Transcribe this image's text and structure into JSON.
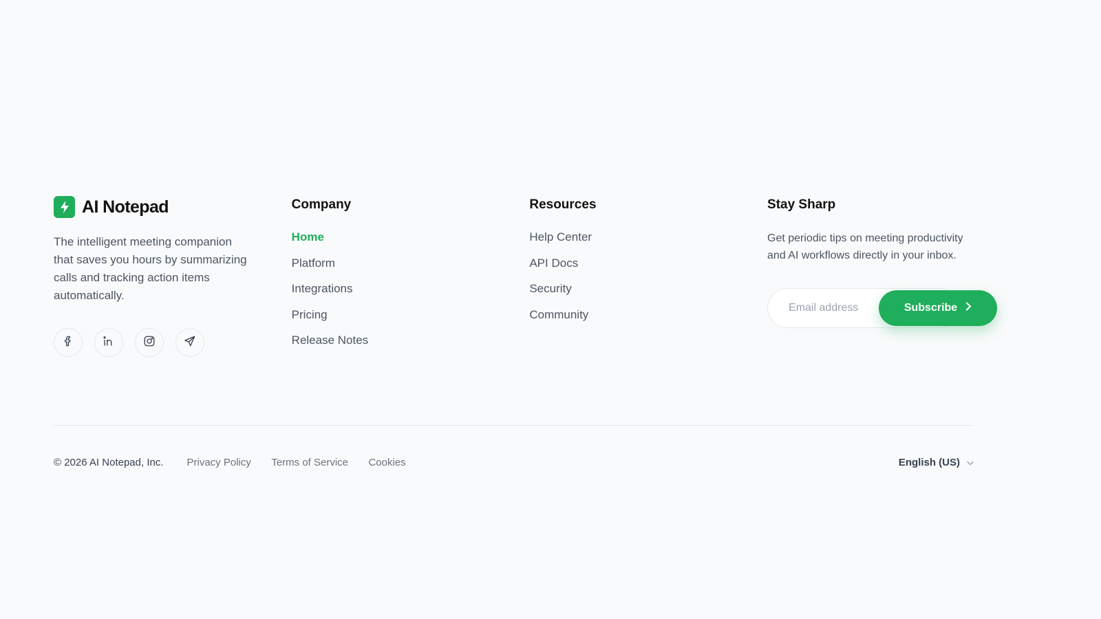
{
  "brand": {
    "name": "AI Notepad",
    "icon": "lightning-bolt-icon",
    "accent": "#1fae5b",
    "description": "The intelligent meeting companion that saves you hours by summarizing calls and tracking action items automatically."
  },
  "socials": [
    {
      "icon": "facebook-icon"
    },
    {
      "icon": "linkedin-icon"
    },
    {
      "icon": "instagram-icon"
    },
    {
      "icon": "telegram-icon"
    }
  ],
  "company": {
    "title": "Company",
    "links": [
      "Home",
      "Platform",
      "Integrations",
      "Pricing",
      "Release Notes"
    ],
    "active": "Home"
  },
  "resources": {
    "title": "Resources",
    "links": [
      "Help Center",
      "API Docs",
      "Security",
      "Community"
    ]
  },
  "newsletter": {
    "title": "Stay Sharp",
    "description": "Get periodic tips on meeting productivity and AI workflows directly in your inbox.",
    "email_placeholder": "Email address",
    "email_value": "",
    "button_label": "Subscribe",
    "button_icon": "chevron-right-icon"
  },
  "bottom": {
    "copyright": "© 2026 AI Notepad, Inc.",
    "legal": [
      "Privacy Policy",
      "Terms of Service",
      "Cookies"
    ],
    "language": "English (US)",
    "language_icon": "chevron-down-icon"
  }
}
